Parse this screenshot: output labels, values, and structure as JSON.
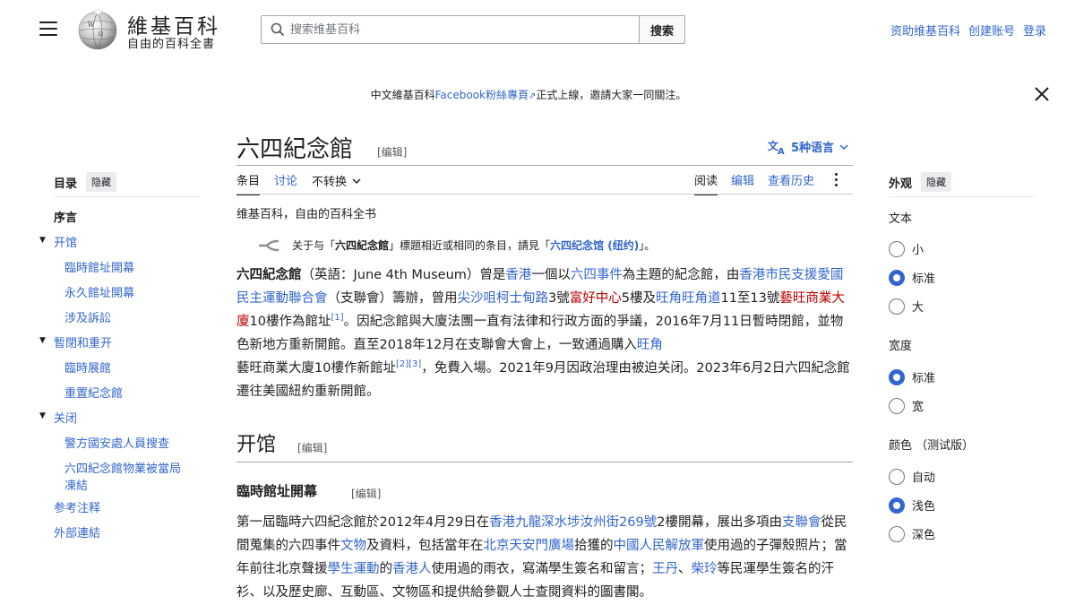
{
  "header": {
    "logo_title": "維基百科",
    "logo_subtitle": "自由的百科全書",
    "search_placeholder": "搜索维基百科",
    "search_button": "搜索",
    "links": [
      "资助维基百科",
      "创建账号",
      "登录"
    ]
  },
  "banner": {
    "text_before": "中文維基百科",
    "link": "Facebook粉絲專頁",
    "text_after": "正式上線，邀請大家一同關注。"
  },
  "article": {
    "title": "六四紀念館",
    "edit_label": "[编辑]",
    "languages_label": "5种语言",
    "tabs_left": [
      "条目",
      "讨论",
      "不转换"
    ],
    "tabs_right": [
      "阅读",
      "编辑",
      "查看历史"
    ],
    "subtitle": "维基百科，自由的百科全书",
    "hatnote": {
      "prefix": "关于与「",
      "bold": "六四紀念館",
      "middle": "」標題相近或相同的条目，請見「",
      "link": "六四纪念馆 (纽约)",
      "suffix": "」。"
    },
    "section_h2": "开馆",
    "section_h3": "臨時館址開幕"
  },
  "intro": {
    "t1": "六四紀念館",
    "t2": "（英語：June 4th Museum）曾是",
    "l1": "香港",
    "t3": "一個以",
    "l2": "六四事件",
    "t4": "為主題的紀念館，由",
    "l3": "香港市民支援愛國民主運動聯合會",
    "t5": "（支聯會）籌辦，曾用",
    "l4": "尖沙咀柯士甸路",
    "t6": "3號",
    "r1": "富好中心",
    "t7": "5樓及",
    "l5": "旺角",
    "l6": "旺角道",
    "t8": "11至13號",
    "r2": "藝旺商業大廈",
    "t9": "10樓作為館址",
    "ref1": "[1]",
    "t10": "。因紀念館與大廈法團一直有法律和行政方面的爭議，2016年7月11日暫時閉館，並物色新地方重新開館。直至2018年12月在支聯會大會上，一致通過購入",
    "l7": "旺角",
    "t11": "藝旺商業大廈10樓作新館址",
    "ref2": "[2]",
    "ref3": "[3]",
    "t12": "，免費入場。2021年9月因政治理由被迫关闭。2023年6月2日六四紀念館遷往美國紐約重新開館。"
  },
  "body2": {
    "t1": "第一屆臨時六四紀念館於2012年4月29日在",
    "l1": "香港九龍深水埗汝州街269號",
    "t2": "2樓開幕，展出多項由",
    "l2": "支聯會",
    "t3": "從民間蒐集的六四事件",
    "l3": "文物",
    "t4": "及資料，包括當年在",
    "l4": "北京天安門廣場",
    "t5": "拾獲的",
    "l5": "中國人民解放軍",
    "t6": "使用過的子彈殼照片；當年前往北京聲援",
    "l6": "學生運動",
    "t7": "的",
    "l7": "香港人",
    "t8": "使用過的雨衣，寫滿學生簽名和留言；",
    "l8": "王丹",
    "t9": "、",
    "l9": "柴玲",
    "t10": "等民運學生簽名的汗衫、以及歷史廊、互動區、文物區和提供給參觀人士查閱資料的圖書閣。"
  },
  "toc": {
    "title": "目录",
    "hide": "隐藏",
    "items": [
      "序言",
      "开馆",
      "臨時館址開幕",
      "永久館址開幕",
      "涉及訴訟",
      "暫閉和重开",
      "臨時展館",
      "重置紀念館",
      "关闭",
      "警方國安處人員搜查",
      "六四紀念館物業被當局",
      "凍結",
      "参考注释",
      "外部連結"
    ]
  },
  "appearance": {
    "title": "外观",
    "hide": "隐藏",
    "text_label": "文本",
    "text_options": [
      "小",
      "标准",
      "大"
    ],
    "width_label": "宽度",
    "width_options": [
      "标准",
      "宽"
    ],
    "color_label": "颜色 （测试版）",
    "color_options": [
      "自动",
      "浅色",
      "深色"
    ]
  },
  "colors": {
    "link": "#3366cc",
    "redlink": "#ba0000",
    "radio_selected": "#3366cc"
  }
}
